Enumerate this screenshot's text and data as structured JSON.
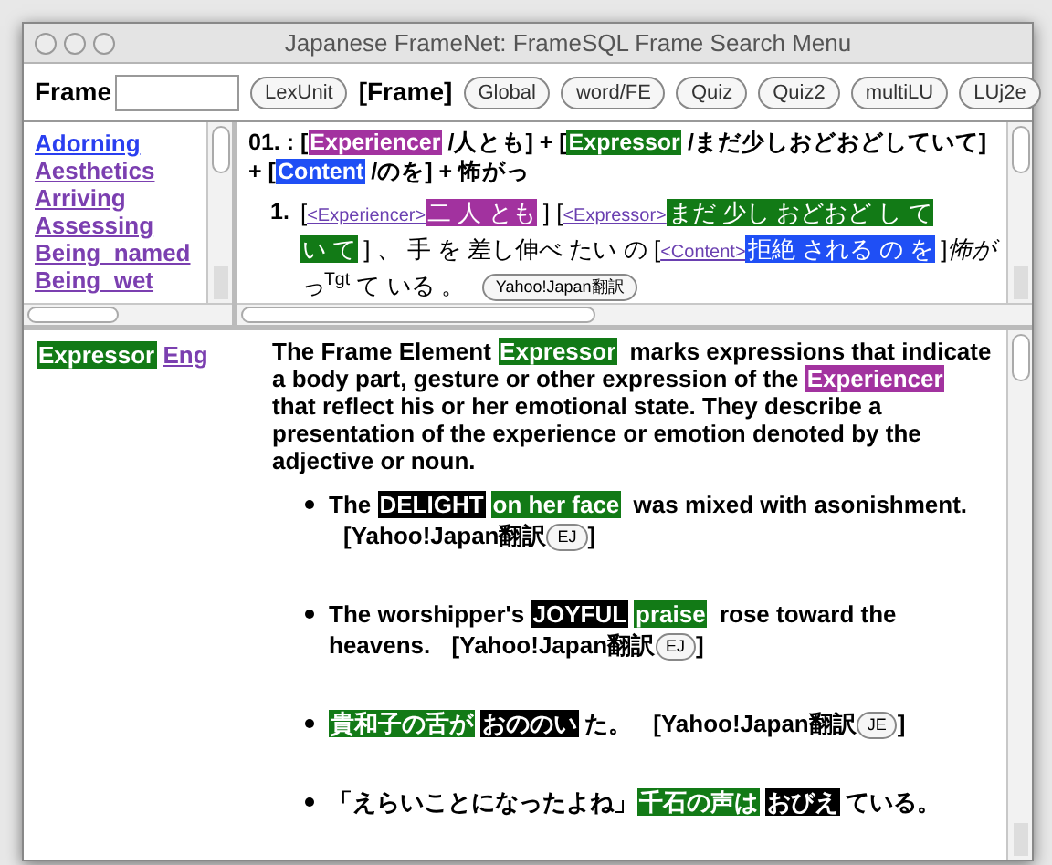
{
  "window": {
    "title": "Japanese FrameNet: FrameSQL Frame Search Menu"
  },
  "toolbar": {
    "label": "Frame",
    "items": [
      {
        "kind": "button",
        "text": "LexUnit"
      },
      {
        "kind": "current",
        "text": "[Frame]"
      },
      {
        "kind": "button",
        "text": "Global"
      },
      {
        "kind": "button",
        "text": "word/FE"
      },
      {
        "kind": "button",
        "text": "Quiz"
      },
      {
        "kind": "button",
        "text": "Quiz2"
      },
      {
        "kind": "button",
        "text": "multiLU"
      },
      {
        "kind": "button",
        "text": "LUj2e"
      }
    ]
  },
  "frame_list": [
    {
      "text": "Adorning",
      "visited": false
    },
    {
      "text": "Aesthetics",
      "visited": true
    },
    {
      "text": "Arriving",
      "visited": true
    },
    {
      "text": "Assessing",
      "visited": true
    },
    {
      "text": "Being_named",
      "visited": true
    },
    {
      "text": "Being_wet",
      "visited": true
    }
  ],
  "pattern": [
    {
      "kind": "plain",
      "text": "01. : ["
    },
    {
      "kind": "fe",
      "text": "Experiencer",
      "color": "#a2329f"
    },
    {
      "kind": "plain",
      "text": "/人とも] + ["
    },
    {
      "kind": "fe",
      "text": "Expressor",
      "color": "#127a16"
    },
    {
      "kind": "plain",
      "text": "/まだ少しおどおどしていて] + ["
    },
    {
      "kind": "fe",
      "text": "Content",
      "color": "#1f4ff5"
    },
    {
      "kind": "plain",
      "text": "/のを] + 怖がっ"
    }
  ],
  "annotated_example": {
    "number": "1.",
    "segments": [
      {
        "kind": "plain",
        "text": "["
      },
      {
        "kind": "tag",
        "text": "<Experiencer>"
      },
      {
        "kind": "fe",
        "text": "二 人 とも",
        "color": "#a2329f"
      },
      {
        "kind": "plain",
        "text": "] ["
      },
      {
        "kind": "tag",
        "text": "<Expressor>"
      },
      {
        "kind": "fe",
        "text": "まだ 少し おどおど し て",
        "color": "#127a16"
      },
      {
        "kind": "fe",
        "text": "い て",
        "color": "#127a16"
      },
      {
        "kind": "plain",
        "text": "] 、 手 を 差し伸べ たい の ["
      },
      {
        "kind": "tag",
        "text": "<Content>"
      },
      {
        "kind": "fe",
        "text": "拒絶 される の を",
        "color": "#1f4ff5"
      },
      {
        "kind": "plain",
        "text": "]"
      },
      {
        "kind": "rich",
        "text": "*怖がっ*$^{Tgt}$ て いる 。"
      }
    ],
    "translate": "Yahoo!Japan翻訳"
  },
  "definition": {
    "fe": {
      "text": "Expressor",
      "color": "#127a16"
    },
    "language_link": "Eng",
    "segments": [
      {
        "kind": "plain",
        "text": "The Frame Element "
      },
      {
        "kind": "fe",
        "text": "Expressor",
        "color": "#127a16"
      },
      {
        "kind": "plain",
        "text": " marks expressions that indicate a body part, gesture or other expression of the "
      },
      {
        "kind": "fe",
        "text": "Experiencer",
        "color": "#a2329f"
      },
      {
        "kind": "plain",
        "text": " that reflect his or her emotional state. They describe a presentation of the experience or emotion denoted by the adjective or noun."
      }
    ]
  },
  "examples": [
    {
      "segments": [
        {
          "kind": "plain",
          "text": "The "
        },
        {
          "kind": "target",
          "text": "DELIGHT"
        },
        {
          "kind": "fe",
          "text": "on her face",
          "color": "#127a16"
        },
        {
          "kind": "plain",
          "text": " was mixed with asonishment."
        }
      ],
      "translate": {
        "label": "[Yahoo!Japan翻訳",
        "button": "EJ",
        "close": "]"
      }
    },
    {
      "segments": [
        {
          "kind": "plain",
          "text": "The worshipper's "
        },
        {
          "kind": "target",
          "text": "JOYFUL"
        },
        {
          "kind": "fe",
          "text": "praise",
          "color": "#127a16"
        },
        {
          "kind": "plain",
          "text": " rose toward the heavens."
        }
      ],
      "translate": {
        "label": "[Yahoo!Japan翻訳",
        "button": "EJ",
        "close": "]"
      }
    },
    {
      "segments": [
        {
          "kind": "fe",
          "text": "貴和子の舌が",
          "color": "#127a16"
        },
        {
          "kind": "target",
          "text": "おののい"
        },
        {
          "kind": "plain",
          "text": "た。"
        }
      ],
      "translate": {
        "label": "[Yahoo!Japan翻訳",
        "button": "JE",
        "close": "]"
      }
    },
    {
      "segments": [
        {
          "kind": "plain",
          "text": "「えらいことになったよね」"
        },
        {
          "kind": "fe",
          "text": "千石の声は",
          "color": "#127a16"
        },
        {
          "kind": "target",
          "text": "おびえ"
        },
        {
          "kind": "plain",
          "text": "ている。"
        }
      ]
    }
  ]
}
